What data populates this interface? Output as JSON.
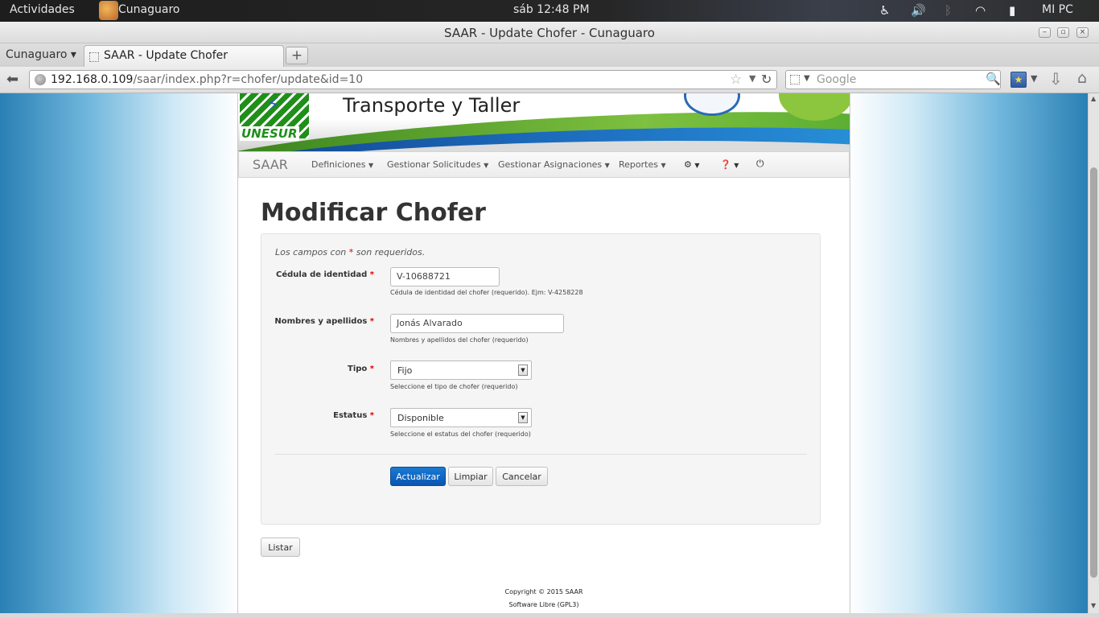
{
  "system_bar": {
    "activities": "Actividades",
    "app_name": "Cunaguaro",
    "clock": "sáb 12:48 PM",
    "user": "MI PC"
  },
  "window": {
    "title": "SAAR - Update Chofer - Cunaguaro"
  },
  "tabs": {
    "group_label": "Cunaguaro ▾",
    "active_tab": "SAAR - Update Chofer",
    "new_tab": "+"
  },
  "navigation": {
    "url_host": "192.168.0.109",
    "url_path": "/saar/index.php?r=chofer/update&id=10",
    "search_placeholder": "Google"
  },
  "banner": {
    "title": "Transporte y Taller",
    "logo_text": "UNESUR"
  },
  "menu": {
    "brand": "SAAR",
    "items": [
      {
        "label": "Definiciones"
      },
      {
        "label": "Gestionar Solicitudes"
      },
      {
        "label": "Gestionar Asignaciones"
      },
      {
        "label": "Reportes"
      }
    ]
  },
  "form": {
    "heading": "Modificar Chofer",
    "note_before": "Los campos con ",
    "note_star": "*",
    "note_after": " son requeridos.",
    "required_mark": "*",
    "fields": {
      "cedula": {
        "label": "Cédula de identidad",
        "value": "V-10688721",
        "help": "Cédula de identidad del chofer (requerido). Ejm: V-4258228"
      },
      "nombres": {
        "label": "Nombres y apellidos",
        "value": "Jonás Alvarado",
        "help": "Nombres y apellidos del chofer (requerido)"
      },
      "tipo": {
        "label": "Tipo",
        "value": "Fijo",
        "help": "Seleccione el tipo de chofer (requerido)"
      },
      "estatus": {
        "label": "Estatus",
        "value": "Disponible",
        "help": "Seleccione el estatus del chofer (requerido)"
      }
    },
    "buttons": {
      "update": "Actualizar",
      "clear": "Limpiar",
      "cancel": "Cancelar"
    }
  },
  "list_button": "Listar",
  "footer": {
    "copyright": "Copyright © 2015 SAAR",
    "license": "Software Libre (GPL3)"
  },
  "colors": {
    "primary_button": "#0a55b0",
    "required": "#dd0000"
  }
}
